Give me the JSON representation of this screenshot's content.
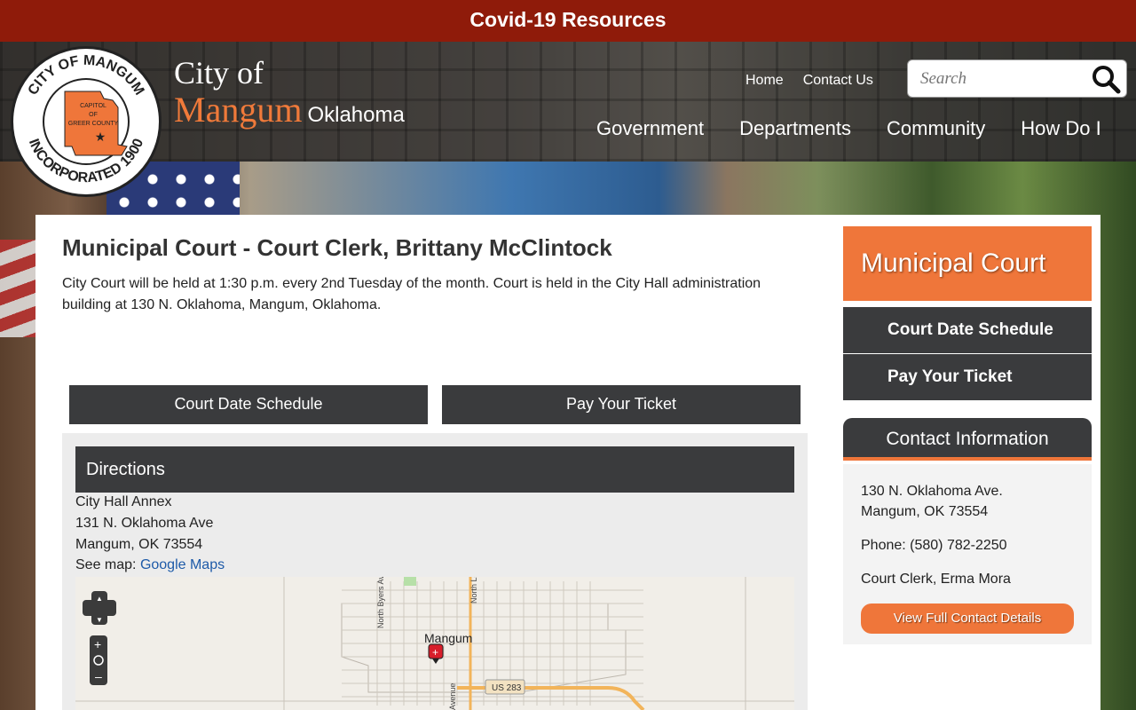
{
  "banner": {
    "text": "Covid-19 Resources"
  },
  "brand": {
    "seal_top": "CITY OF MANGUM",
    "seal_bottom": "INCORPORATED 1900",
    "seal_center": [
      "CAPITOL",
      "OF",
      "GREER COUNTY"
    ],
    "city_of": "City of",
    "name": "Mangum",
    "state": "Oklahoma"
  },
  "toplinks": [
    "Home",
    "Contact Us"
  ],
  "search": {
    "placeholder": "Search"
  },
  "mainnav": [
    "Government",
    "Departments",
    "Community",
    "How Do I"
  ],
  "main": {
    "title": "Municipal Court - Court Clerk, Brittany McClintock",
    "intro": "City Court will be held at 1:30 p.m. every 2nd Tuesday of the month. Court is held in the City Hall administration building at 130 N. Oklahoma, Mangum, Oklahoma.",
    "buttons": [
      "Court Date Schedule",
      "Pay Your Ticket"
    ],
    "directions": {
      "heading": "Directions",
      "name": "City Hall Annex",
      "street": "131 N. Oklahoma Ave",
      "citystate": "Mangum, OK 73554",
      "map_prefix": "See map:",
      "map_link": "Google Maps"
    },
    "map": {
      "town": "Mangum",
      "road1": "North Byers Ave",
      "road2": "North Louis",
      "highway": "US 283",
      "road3": "Avenue"
    }
  },
  "sidebar": {
    "title": "Municipal Court",
    "links": [
      "Court Date Schedule",
      "Pay Your Ticket"
    ],
    "contact": {
      "heading": "Contact Information",
      "addr1": "130 N. Oklahoma Ave.",
      "addr2": "Mangum, OK 73554",
      "phone": "Phone: (580) 782-2250",
      "clerk": "Court Clerk, Erma Mora",
      "button": "View Full Contact Details"
    }
  },
  "colors": {
    "accent": "#ef763a",
    "banner": "#8f1b0a",
    "dark": "#3a3b3d",
    "link": "#1d5aa8"
  }
}
